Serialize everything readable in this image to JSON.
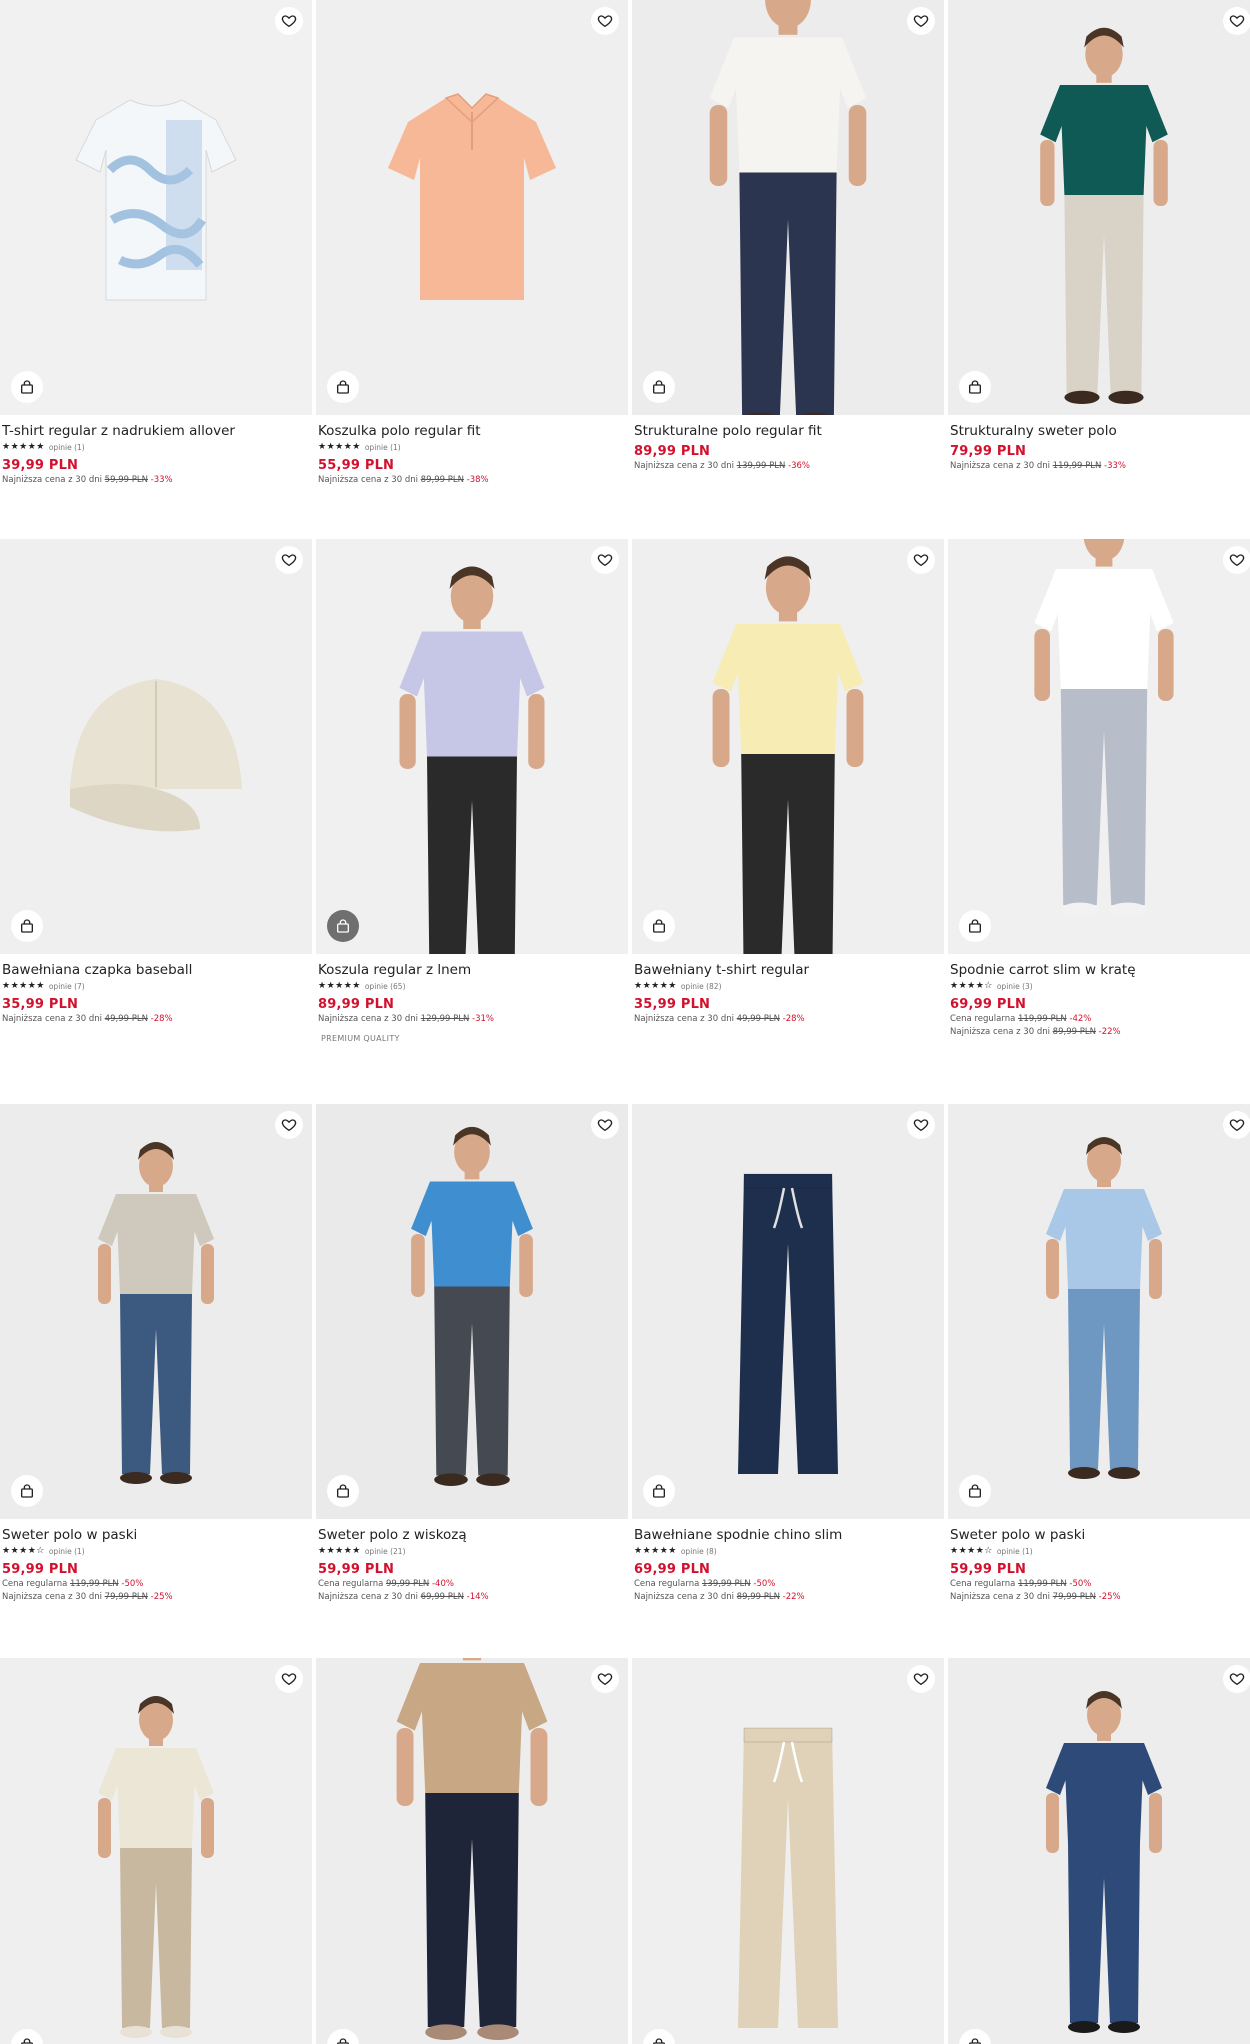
{
  "products": [
    {
      "name": "T-shirt regular z nadrukiem allover",
      "stars": "★★★★★",
      "reviews": "opinie (1)",
      "price": "39,99 PLN",
      "lines": [
        {
          "label": "Najniższa cena z 30 dni",
          "old": "59,99 PLN",
          "pct": "-33%"
        }
      ]
    },
    {
      "name": "Koszulka polo regular fit",
      "stars": "★★★★★",
      "reviews": "opinie (1)",
      "price": "55,99 PLN",
      "lines": [
        {
          "label": "Najniższa cena z 30 dni",
          "old": "89,99 PLN",
          "pct": "-38%"
        }
      ]
    },
    {
      "name": "Strukturalne polo regular fit",
      "stars": "",
      "reviews": "",
      "price": "89,99 PLN",
      "lines": [
        {
          "label": "Najniższa cena z 30 dni",
          "old": "139,99 PLN",
          "pct": "-36%"
        }
      ]
    },
    {
      "name": "Strukturalny sweter polo",
      "stars": "",
      "reviews": "",
      "price": "79,99 PLN",
      "lines": [
        {
          "label": "Najniższa cena z 30 dni",
          "old": "119,99 PLN",
          "pct": "-33%"
        }
      ]
    },
    {
      "name": "Bawełniana czapka baseball",
      "stars": "★★★★★",
      "reviews": "opinie (7)",
      "price": "35,99 PLN",
      "lines": [
        {
          "label": "Najniższa cena z 30 dni",
          "old": "49,99 PLN",
          "pct": "-28%"
        }
      ]
    },
    {
      "name": "Koszula regular z lnem",
      "stars": "★★★★★",
      "reviews": "opinie (65)",
      "price": "89,99 PLN",
      "lines": [
        {
          "label": "Najniższa cena z 30 dni",
          "old": "129,99 PLN",
          "pct": "-31%"
        }
      ],
      "badge": "PREMIUM QUALITY"
    },
    {
      "name": "Bawełniany t-shirt regular",
      "stars": "★★★★★",
      "reviews": "opinie (82)",
      "price": "35,99 PLN",
      "lines": [
        {
          "label": "Najniższa cena z 30 dni",
          "old": "49,99 PLN",
          "pct": "-28%"
        }
      ]
    },
    {
      "name": "Spodnie carrot slim w kratę",
      "stars": "★★★★☆",
      "reviews": "opinie (3)",
      "price": "69,99 PLN",
      "lines": [
        {
          "label": "Cena regularna",
          "old": "119,99 PLN",
          "pct": "-42%"
        },
        {
          "label": "Najniższa cena z 30 dni",
          "old": "89,99 PLN",
          "pct": "-22%"
        }
      ]
    },
    {
      "name": "Sweter polo w paski",
      "stars": "★★★★☆",
      "reviews": "opinie (1)",
      "price": "59,99 PLN",
      "lines": [
        {
          "label": "Cena regularna",
          "old": "119,99 PLN",
          "pct": "-50%"
        },
        {
          "label": "Najniższa cena z 30 dni",
          "old": "79,99 PLN",
          "pct": "-25%"
        }
      ]
    },
    {
      "name": "Sweter polo z wiskozą",
      "stars": "★★★★★",
      "reviews": "opinie (21)",
      "price": "59,99 PLN",
      "lines": [
        {
          "label": "Cena regularna",
          "old": "99,99 PLN",
          "pct": "-40%"
        },
        {
          "label": "Najniższa cena z 30 dni",
          "old": "69,99 PLN",
          "pct": "-14%"
        }
      ]
    },
    {
      "name": "Bawełniane spodnie chino slim",
      "stars": "★★★★★",
      "reviews": "opinie (8)",
      "price": "69,99 PLN",
      "lines": [
        {
          "label": "Cena regularna",
          "old": "139,99 PLN",
          "pct": "-50%"
        },
        {
          "label": "Najniższa cena z 30 dni",
          "old": "89,99 PLN",
          "pct": "-22%"
        }
      ]
    },
    {
      "name": "Sweter polo w paski",
      "stars": "★★★★☆",
      "reviews": "opinie (1)",
      "price": "59,99 PLN",
      "lines": [
        {
          "label": "Cena regularna",
          "old": "119,99 PLN",
          "pct": "-50%"
        },
        {
          "label": "Najniższa cena z 30 dni",
          "old": "79,99 PLN",
          "pct": "-25%"
        }
      ]
    },
    {
      "name": "",
      "stars": "",
      "reviews": "",
      "price": "",
      "lines": []
    },
    {
      "name": "",
      "stars": "",
      "reviews": "",
      "price": "",
      "lines": []
    },
    {
      "name": "",
      "stars": "",
      "reviews": "",
      "price": "",
      "lines": []
    },
    {
      "name": "",
      "stars": "",
      "reviews": "",
      "price": "",
      "lines": []
    }
  ],
  "icons": {
    "favorite": "heart-icon",
    "add_to_bag": "shopping-bag-icon"
  },
  "colors": {
    "sale_price": "#d1112d"
  }
}
